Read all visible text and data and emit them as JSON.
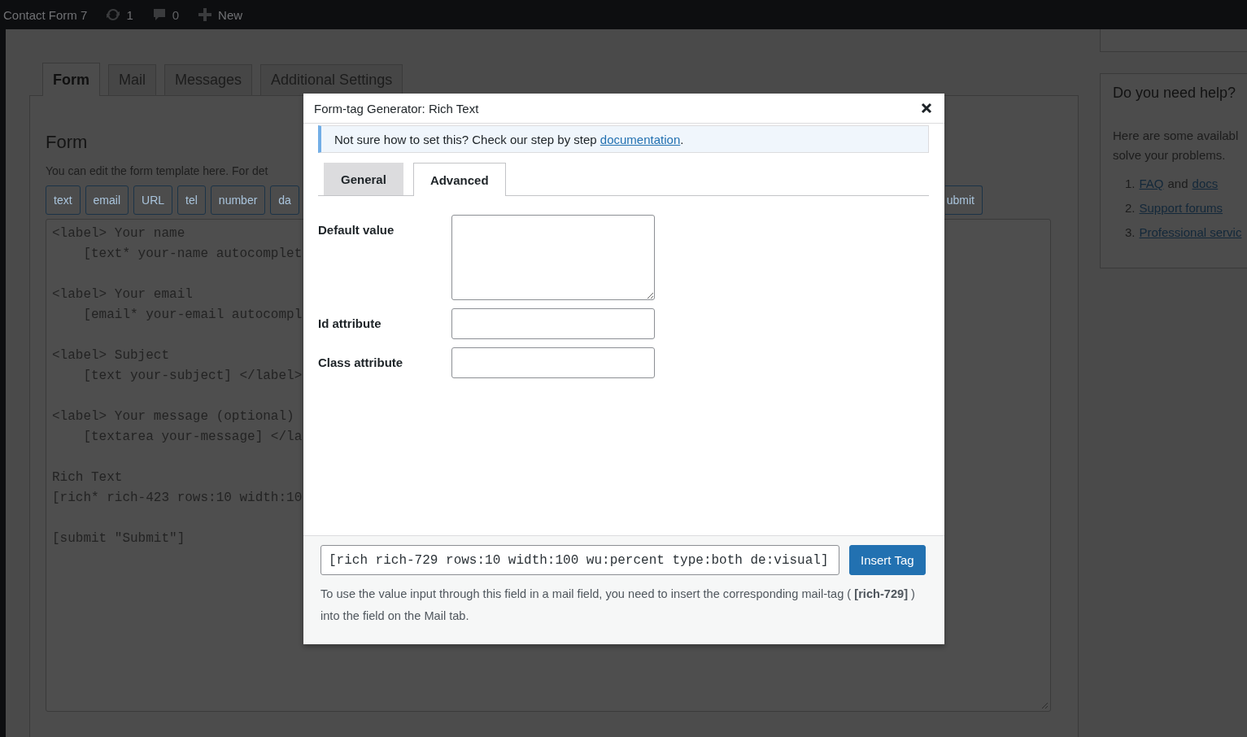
{
  "admin_bar": {
    "site": "Contact Form 7",
    "updates": "1",
    "comments": "0",
    "new": "New"
  },
  "editor_tabs": [
    {
      "label": "Form",
      "selected": true
    },
    {
      "label": "Mail",
      "selected": false
    },
    {
      "label": "Messages",
      "selected": false
    },
    {
      "label": "Additional Settings",
      "selected": false
    }
  ],
  "form_panel": {
    "heading": "Form",
    "description": "You can edit the form template here. For det",
    "tag_buttons": [
      "text",
      "email",
      "URL",
      "tel",
      "number",
      "da"
    ],
    "tag_button_right": "ubmit",
    "template_blocks": [
      [
        "<label> Your name",
        "    [text* your-name autocomplet"
      ],
      [
        "<label> Your email",
        "    [email* your-email autocompl"
      ],
      [
        "<label> Subject",
        "    [text your-subject] </label>"
      ],
      [
        "<label> Your message (optional)",
        "    [textarea your-message] </la"
      ],
      [
        "Rich Text",
        "[rich* rich-423 rows:10 width:10"
      ],
      [
        "[submit \"Submit\"]"
      ]
    ]
  },
  "sidebar": {
    "help_title": "Do you need help?",
    "help_lines": [
      "Here are some availabl",
      "solve your problems."
    ],
    "help_items": [
      {
        "number": "1.",
        "parts": [
          {
            "kind": "link",
            "text": "FAQ"
          },
          {
            "kind": "plain",
            "text": "and"
          },
          {
            "kind": "link",
            "text": "docs"
          }
        ]
      },
      {
        "number": "2.",
        "parts": [
          {
            "kind": "link",
            "text": "Support forums"
          }
        ]
      },
      {
        "number": "3.",
        "parts": [
          {
            "kind": "link",
            "text": "Professional servic"
          }
        ]
      }
    ]
  },
  "modal": {
    "title": "Form-tag Generator: Rich Text",
    "notice": {
      "text": "Not sure how to set this? Check our step by step ",
      "link": "documentation",
      "end": "."
    },
    "tabs": [
      {
        "label": "General",
        "selected": false
      },
      {
        "label": "Advanced",
        "selected": true
      }
    ],
    "fields": [
      {
        "label": "Default value",
        "kind": "textarea"
      },
      {
        "label": "Id attribute",
        "kind": "text"
      },
      {
        "label": "Class attribute",
        "kind": "text"
      }
    ],
    "tag_value": "[rich rich-729 rows:10 width:100 wu:percent type:both de:visual]",
    "insert_button": "Insert Tag",
    "note": "To use the value input through this field in a mail field, you need to insert the corresponding mail-tag ( **[rich-729]** ) into the field on the Mail tab."
  }
}
